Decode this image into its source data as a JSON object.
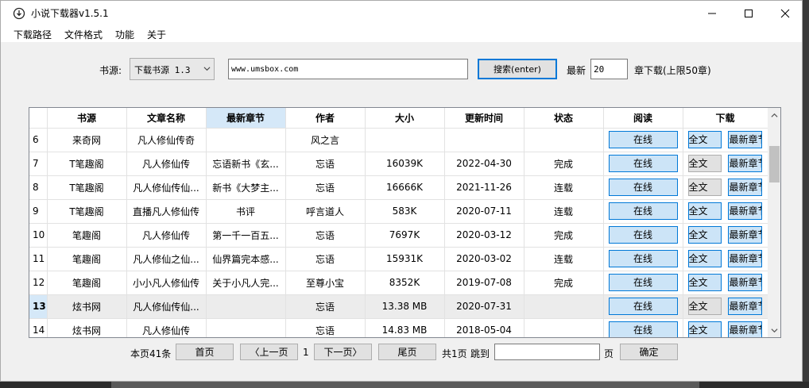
{
  "window": {
    "title": "小说下载器v1.5.1"
  },
  "menu": [
    "下载路径",
    "文件格式",
    "功能",
    "关于"
  ],
  "controls": {
    "source_label": "书源:",
    "source_selected": "下载书源 1.3",
    "search_value": "www.umsbox.com",
    "search_button": "搜索(enter)",
    "latest_label": "最新",
    "latest_value": "20",
    "download_hint": "章下载(上限50章)"
  },
  "table": {
    "columns": [
      "",
      "书源",
      "文章名称",
      "最新章节",
      "作者",
      "大小",
      "更新时间",
      "状态",
      "阅读",
      "下载"
    ],
    "sorted_column": "最新章节",
    "read_button": "在线",
    "full_button": "全文",
    "new_button": "最新章节",
    "rows": [
      {
        "num": "6",
        "source": "来奇网",
        "name": "凡人修仙传奇",
        "latest": "",
        "author": "风之言",
        "size": "",
        "updated": "",
        "status": "",
        "full_highlight": true
      },
      {
        "num": "7",
        "source": "T笔趣阁",
        "name": "凡人修仙传",
        "latest": "忘语新书《玄...",
        "author": "忘语",
        "size": "16039K",
        "updated": "2022-04-30",
        "status": "完成",
        "full_highlight": false
      },
      {
        "num": "8",
        "source": "T笔趣阁",
        "name": "凡人修仙传仙...",
        "latest": "新书《大梦主...",
        "author": "忘语",
        "size": "16666K",
        "updated": "2021-11-26",
        "status": "连载",
        "full_highlight": false
      },
      {
        "num": "9",
        "source": "T笔趣阁",
        "name": "直播凡人修仙传",
        "latest": "书评",
        "author": "呼言道人",
        "size": "583K",
        "updated": "2020-07-11",
        "status": "连载",
        "full_highlight": true
      },
      {
        "num": "10",
        "source": "笔趣阁",
        "name": "凡人修仙传",
        "latest": "第一千一百五...",
        "author": "忘语",
        "size": "7697K",
        "updated": "2020-03-12",
        "status": "完成",
        "full_highlight": true
      },
      {
        "num": "11",
        "source": "笔趣阁",
        "name": "凡人修仙之仙...",
        "latest": "仙界篇完本感...",
        "author": "忘语",
        "size": "15931K",
        "updated": "2020-03-02",
        "status": "连载",
        "full_highlight": true
      },
      {
        "num": "12",
        "source": "笔趣阁",
        "name": "小小凡人修仙传",
        "latest": "关于小凡人完...",
        "author": "至尊小宝",
        "size": "8352K",
        "updated": "2019-07-08",
        "status": "完成",
        "full_highlight": true
      },
      {
        "num": "13",
        "source": "炫书网",
        "name": "凡人修仙传仙...",
        "latest": "",
        "author": "忘语",
        "size": "13.38 MB",
        "updated": "2020-07-31",
        "status": "",
        "full_highlight": false,
        "selected": true
      },
      {
        "num": "14",
        "source": "炫书网",
        "name": "凡人修仙传",
        "latest": "",
        "author": "忘语",
        "size": "14.83 MB",
        "updated": "2018-05-04",
        "status": "",
        "full_highlight": true
      }
    ]
  },
  "pager": {
    "count_label": "本页41条",
    "first": "首页",
    "prev": "〈上一页",
    "current": "1",
    "next": "下一页〉",
    "last": "尾页",
    "total": "共1页",
    "jump_label": "跳到",
    "jump_value": "",
    "page_unit": "页",
    "confirm": "确定"
  }
}
